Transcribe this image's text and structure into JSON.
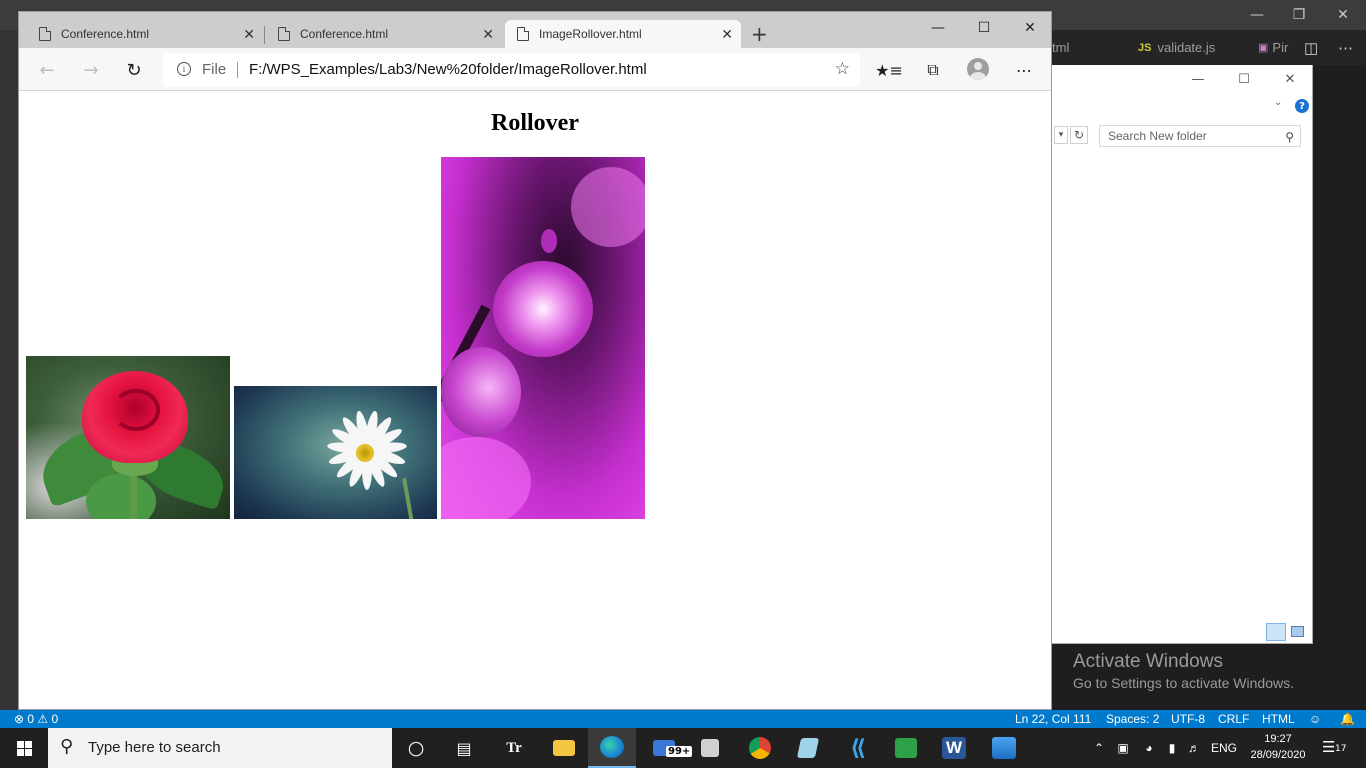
{
  "vscode": {
    "tabs": [
      {
        "label": "tml"
      },
      {
        "label": "validate.js",
        "icon_text": "JS"
      },
      {
        "label": "Pir"
      }
    ],
    "status": {
      "problems": "⊗ 0 ⚠ 0",
      "position": "Ln 22, Col 111",
      "spaces": "Spaces: 2",
      "encoding": "UTF-8",
      "eol": "CRLF",
      "language": "HTML"
    }
  },
  "explorer": {
    "search_placeholder": "Search New folder"
  },
  "activation": {
    "line1": "Activate Windows",
    "line2": "Go to Settings to activate Windows."
  },
  "browser": {
    "tabs": [
      {
        "label": "Conference.html",
        "active": false
      },
      {
        "label": "Conference.html",
        "active": false
      },
      {
        "label": "ImageRollover.html",
        "active": true
      }
    ],
    "address": {
      "scheme_label": "File",
      "url": "F:/WPS_Examples/Lab3/New%20folder/ImageRollover.html"
    },
    "page": {
      "heading": "Rollover",
      "images": [
        "rose",
        "daisy",
        "pink blossom"
      ]
    }
  },
  "taskbar": {
    "search_placeholder": "Type here to search",
    "mail_badge": "99+",
    "language": "ENG",
    "time": "19:27",
    "date": "28/09/2020",
    "notification_count": "17"
  },
  "colors": {
    "vscode_accent": "#007acc",
    "taskbar": "#202020",
    "edge_active_indicator": "#76b9ed"
  }
}
